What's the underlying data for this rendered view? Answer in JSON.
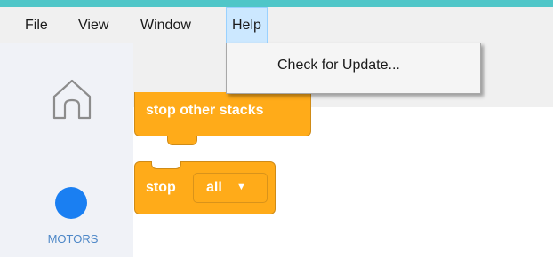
{
  "menubar": {
    "items": [
      {
        "label": "File"
      },
      {
        "label": "View"
      },
      {
        "label": "Window"
      },
      {
        "label": "Help"
      }
    ]
  },
  "help_menu": {
    "items": [
      {
        "label": "Check for Update..."
      }
    ]
  },
  "sidebar": {
    "home_icon": "home-icon",
    "category": {
      "label": "MOTORS",
      "color": "#1a7ff2"
    }
  },
  "blocks": {
    "stop_other": {
      "label": "stop other stacks"
    },
    "stop_all": {
      "label": "stop",
      "dropdown_value": "all",
      "dropdown_icon": "caret-down-icon"
    },
    "color": "#ffab19"
  }
}
